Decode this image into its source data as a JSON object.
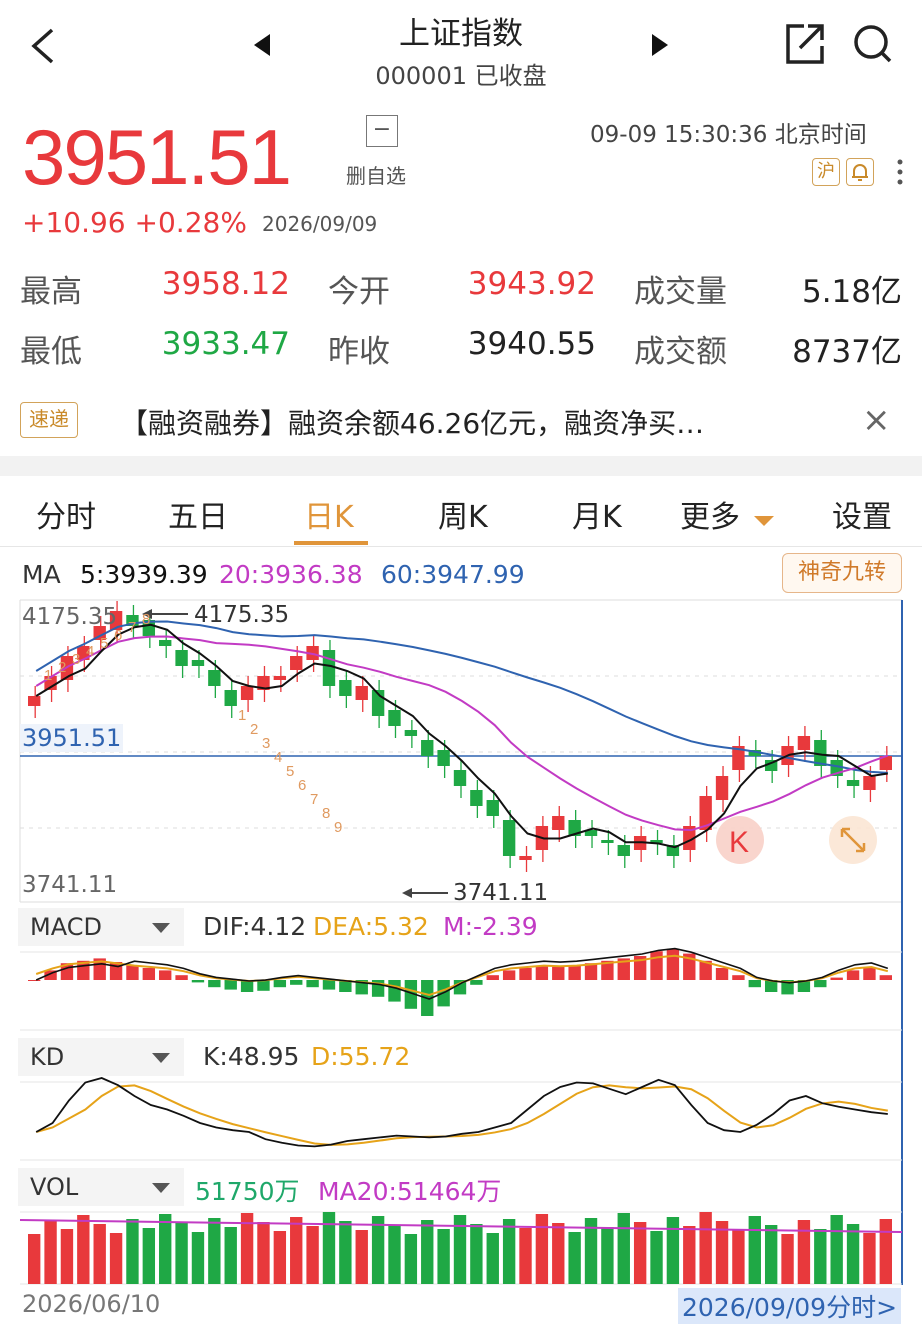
{
  "header": {
    "title": "上证指数",
    "subtitle": "000001 已收盘",
    "back_icon": "chevron-left-icon",
    "prev_icon": "triangle-left-icon",
    "next_icon": "triangle-right-icon",
    "share_icon": "share-external-icon",
    "search_icon": "search-icon"
  },
  "quote": {
    "price": "3951.51",
    "change": "+10.96 +0.28%",
    "date": "2026/09/09",
    "watch_symbol": "−",
    "watch_label": "删自选",
    "time": "09-09 15:30:36 北京时间",
    "market_tag": "沪",
    "alert_icon": "bell-icon",
    "more_icon": "more-vertical-icon"
  },
  "stats": [
    {
      "label": "最高",
      "value": "3958.12",
      "color": "#e8393c"
    },
    {
      "label": "今开",
      "value": "3943.92",
      "color": "#e8393c"
    },
    {
      "label": "成交量",
      "value": "5.18亿",
      "color": "#222222"
    },
    {
      "label": "最低",
      "value": "3933.47",
      "color": "#1fa845"
    },
    {
      "label": "昨收",
      "value": "3940.55",
      "color": "#222222"
    },
    {
      "label": "成交额",
      "value": "8737亿",
      "color": "#222222"
    }
  ],
  "news": {
    "badge": "速递",
    "text": "【融资融券】融资余额46.26亿元，融资净买…",
    "close": "×"
  },
  "tabs": [
    {
      "label": "分时"
    },
    {
      "label": "五日"
    },
    {
      "label": "日K"
    },
    {
      "label": "周K"
    },
    {
      "label": "月K"
    },
    {
      "label": "更多"
    },
    {
      "label": "设置"
    }
  ],
  "active_tab": "日K",
  "ma": {
    "label": "MA",
    "ma5": "5:3939.39",
    "ma20": "20:3936.38",
    "ma60": "60:3947.99",
    "magic_button": "神奇九转"
  },
  "kline": {
    "high_axis": "4175.35",
    "low_axis": "3741.11",
    "current_axis": "3951.51",
    "high_marker": "4175.35",
    "low_marker": "3741.11",
    "k_badge": "K",
    "expand_icon": "expand-icon",
    "nine_top": [
      "1",
      "2",
      "3",
      "4",
      "5",
      "6",
      "7",
      "8"
    ],
    "nine_down": [
      "1",
      "2",
      "3",
      "4",
      "5",
      "6",
      "7",
      "8",
      "9"
    ]
  },
  "macd": {
    "label": "MACD",
    "dif": "DIF:4.12",
    "dea": "DEA:5.32",
    "m": "M:-2.39"
  },
  "kd": {
    "label": "KD",
    "k": "K:48.95",
    "d": "D:55.72"
  },
  "vol": {
    "label": "VOL",
    "value": "51750万",
    "ma20": "MA20:51464万"
  },
  "footer": {
    "start_date": "2026/06/10",
    "end_date": "2026/09/09分时>"
  },
  "colors": {
    "up": "#e8393c",
    "down": "#1fa845",
    "accent": "#e0953a",
    "ma5": "#111111",
    "ma20": "#c23bc4",
    "ma60": "#2f63b0"
  }
}
